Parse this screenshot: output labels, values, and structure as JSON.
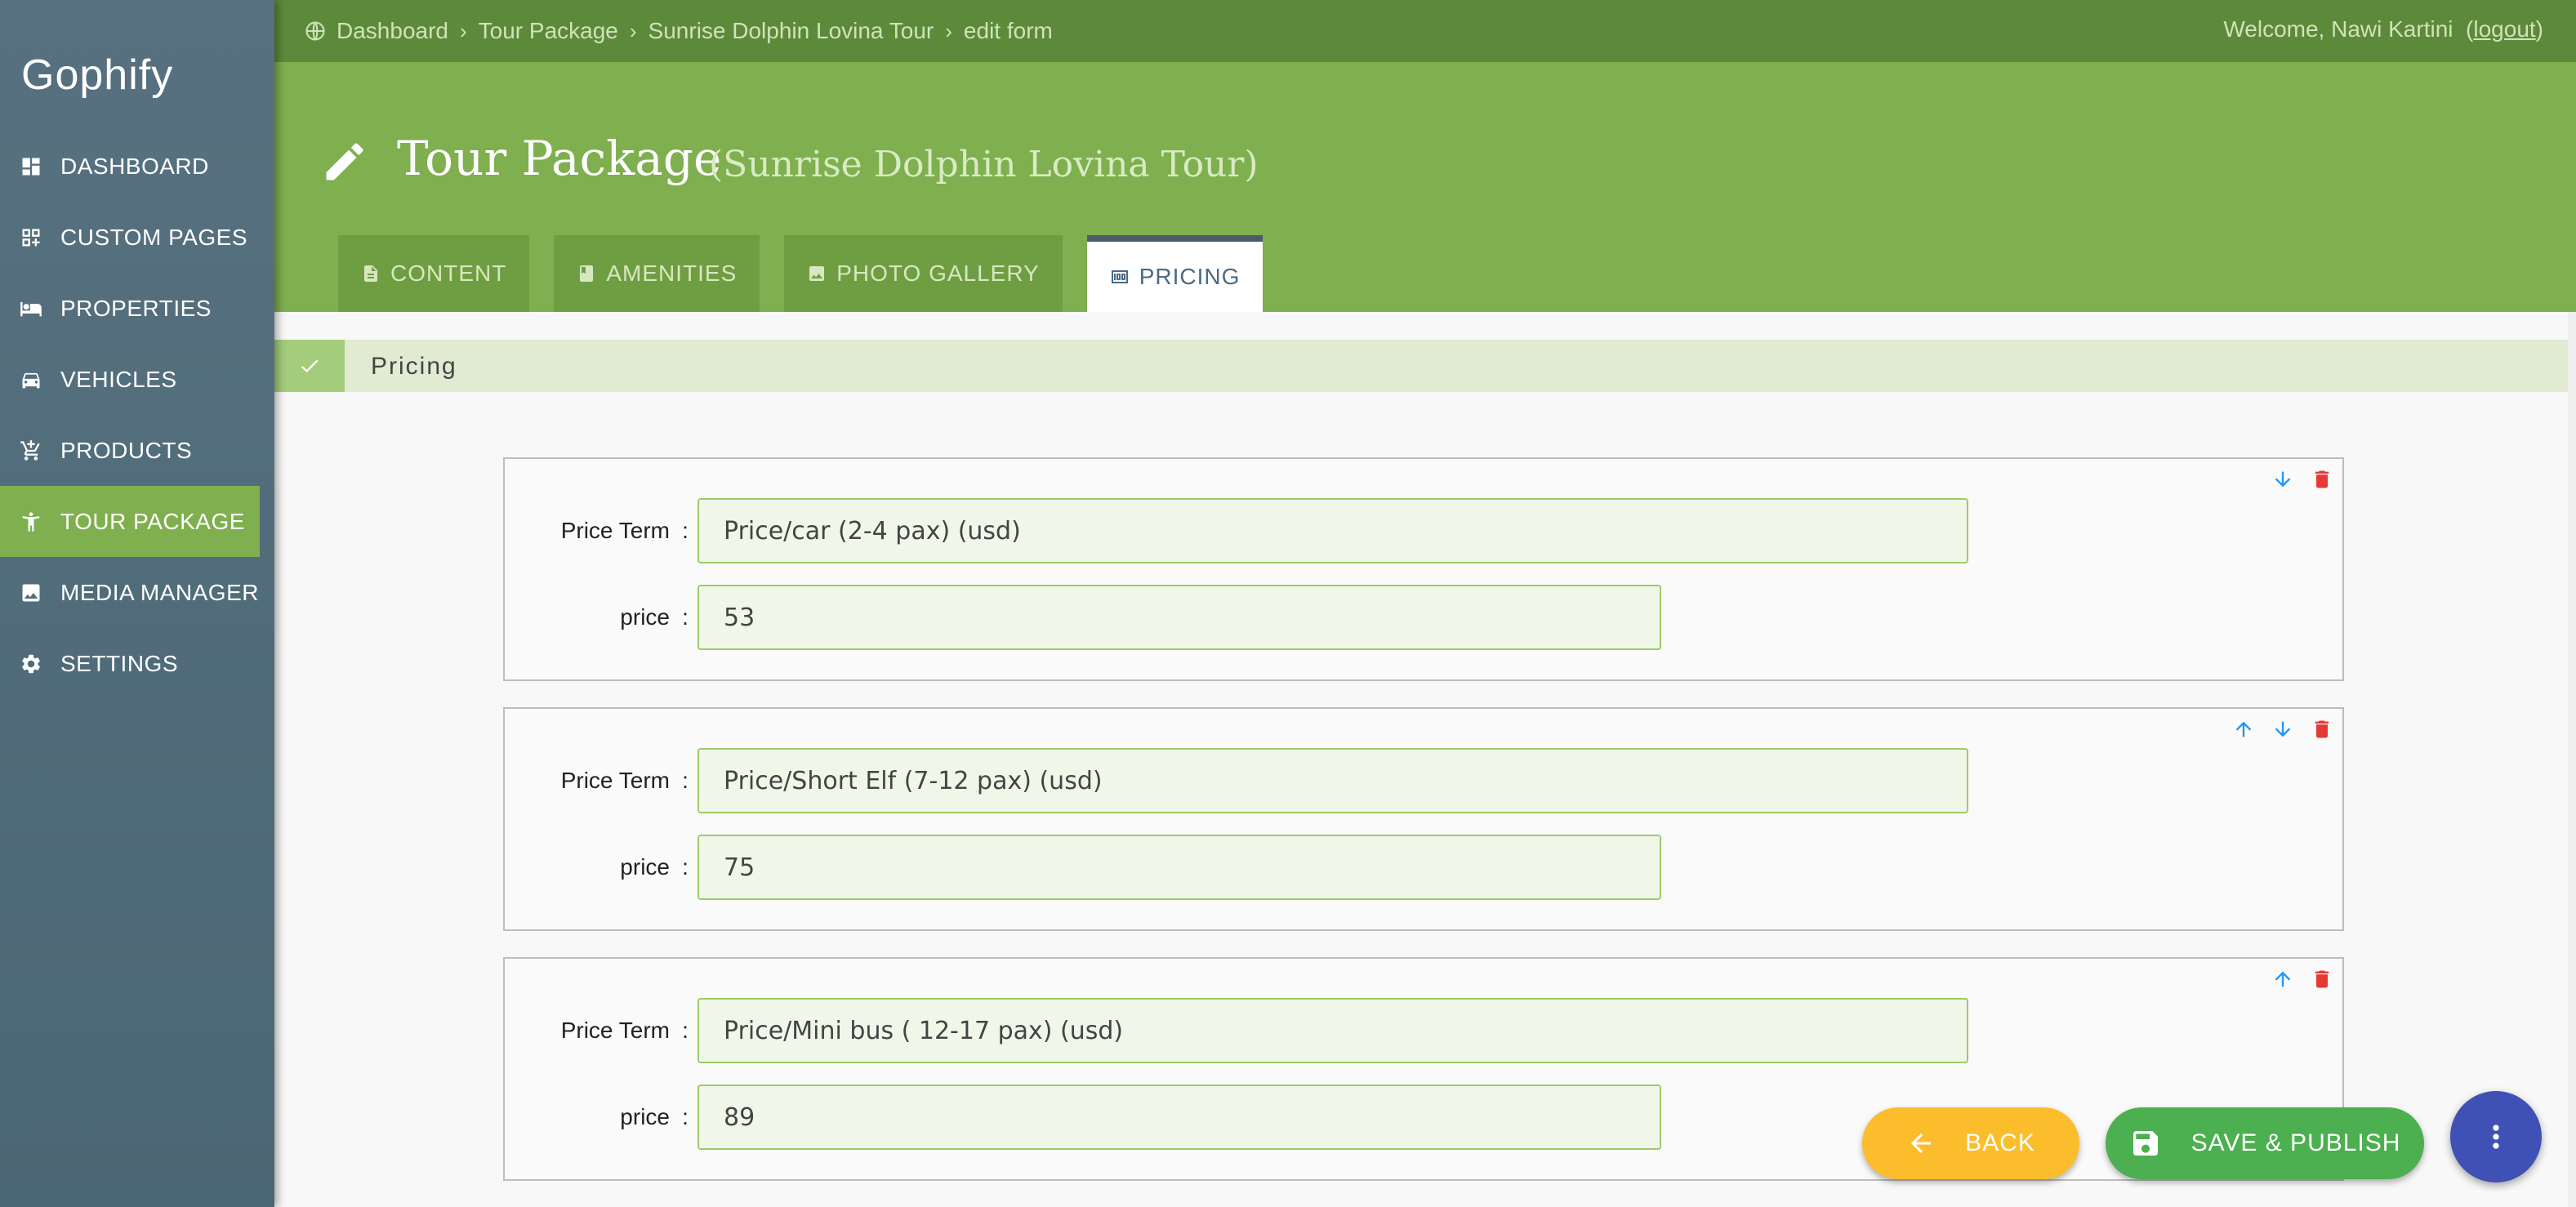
{
  "app": {
    "brand": "Gophify"
  },
  "sidebar": {
    "items": [
      {
        "label": "DASHBOARD",
        "icon": "dashboard-icon"
      },
      {
        "label": "CUSTOM PAGES",
        "icon": "custom-pages-icon"
      },
      {
        "label": "PROPERTIES",
        "icon": "bed-icon"
      },
      {
        "label": "VEHICLES",
        "icon": "car-icon"
      },
      {
        "label": "PRODUCTS",
        "icon": "cart-icon"
      },
      {
        "label": "TOUR PACKAGE",
        "icon": "person-icon",
        "active": true
      },
      {
        "label": "MEDIA MANAGER",
        "icon": "image-icon"
      },
      {
        "label": "SETTINGS",
        "icon": "gear-icon"
      }
    ]
  },
  "topbar": {
    "breadcrumb": [
      "Dashboard",
      "Tour Package",
      "Sunrise Dolphin Lovina Tour",
      "edit form"
    ],
    "welcome": "Welcome, Nawi Kartini",
    "logout": "logout"
  },
  "header": {
    "title": "Tour Package",
    "subtitle": "(Sunrise Dolphin Lovina Tour)",
    "tabs": [
      {
        "label": "CONTENT",
        "icon": "document-icon"
      },
      {
        "label": "AMENITIES",
        "icon": "book-icon"
      },
      {
        "label": "PHOTO GALLERY",
        "icon": "image-icon"
      },
      {
        "label": "PRICING",
        "icon": "money-icon",
        "active": true
      }
    ]
  },
  "section": {
    "label": "Pricing"
  },
  "pricing": {
    "term_label": "Price Term",
    "price_label": "price",
    "colon": ":",
    "items": [
      {
        "term": "Price/car (2-4 pax) (usd)",
        "price": "53"
      },
      {
        "term": "Price/Short Elf (7-12 pax) (usd)",
        "price": "75"
      },
      {
        "term": "Price/Mini bus ( 12-17 pax) (usd)",
        "price": "89"
      }
    ]
  },
  "buttons": {
    "back": "BACK",
    "save": "SAVE & PUBLISH"
  },
  "colors": {
    "sidebar": "#577180",
    "header": "#7faf4f",
    "topbar": "#5d8a3a",
    "back": "#fbbd2c",
    "save": "#4caf50",
    "fab": "#3f51b5"
  }
}
